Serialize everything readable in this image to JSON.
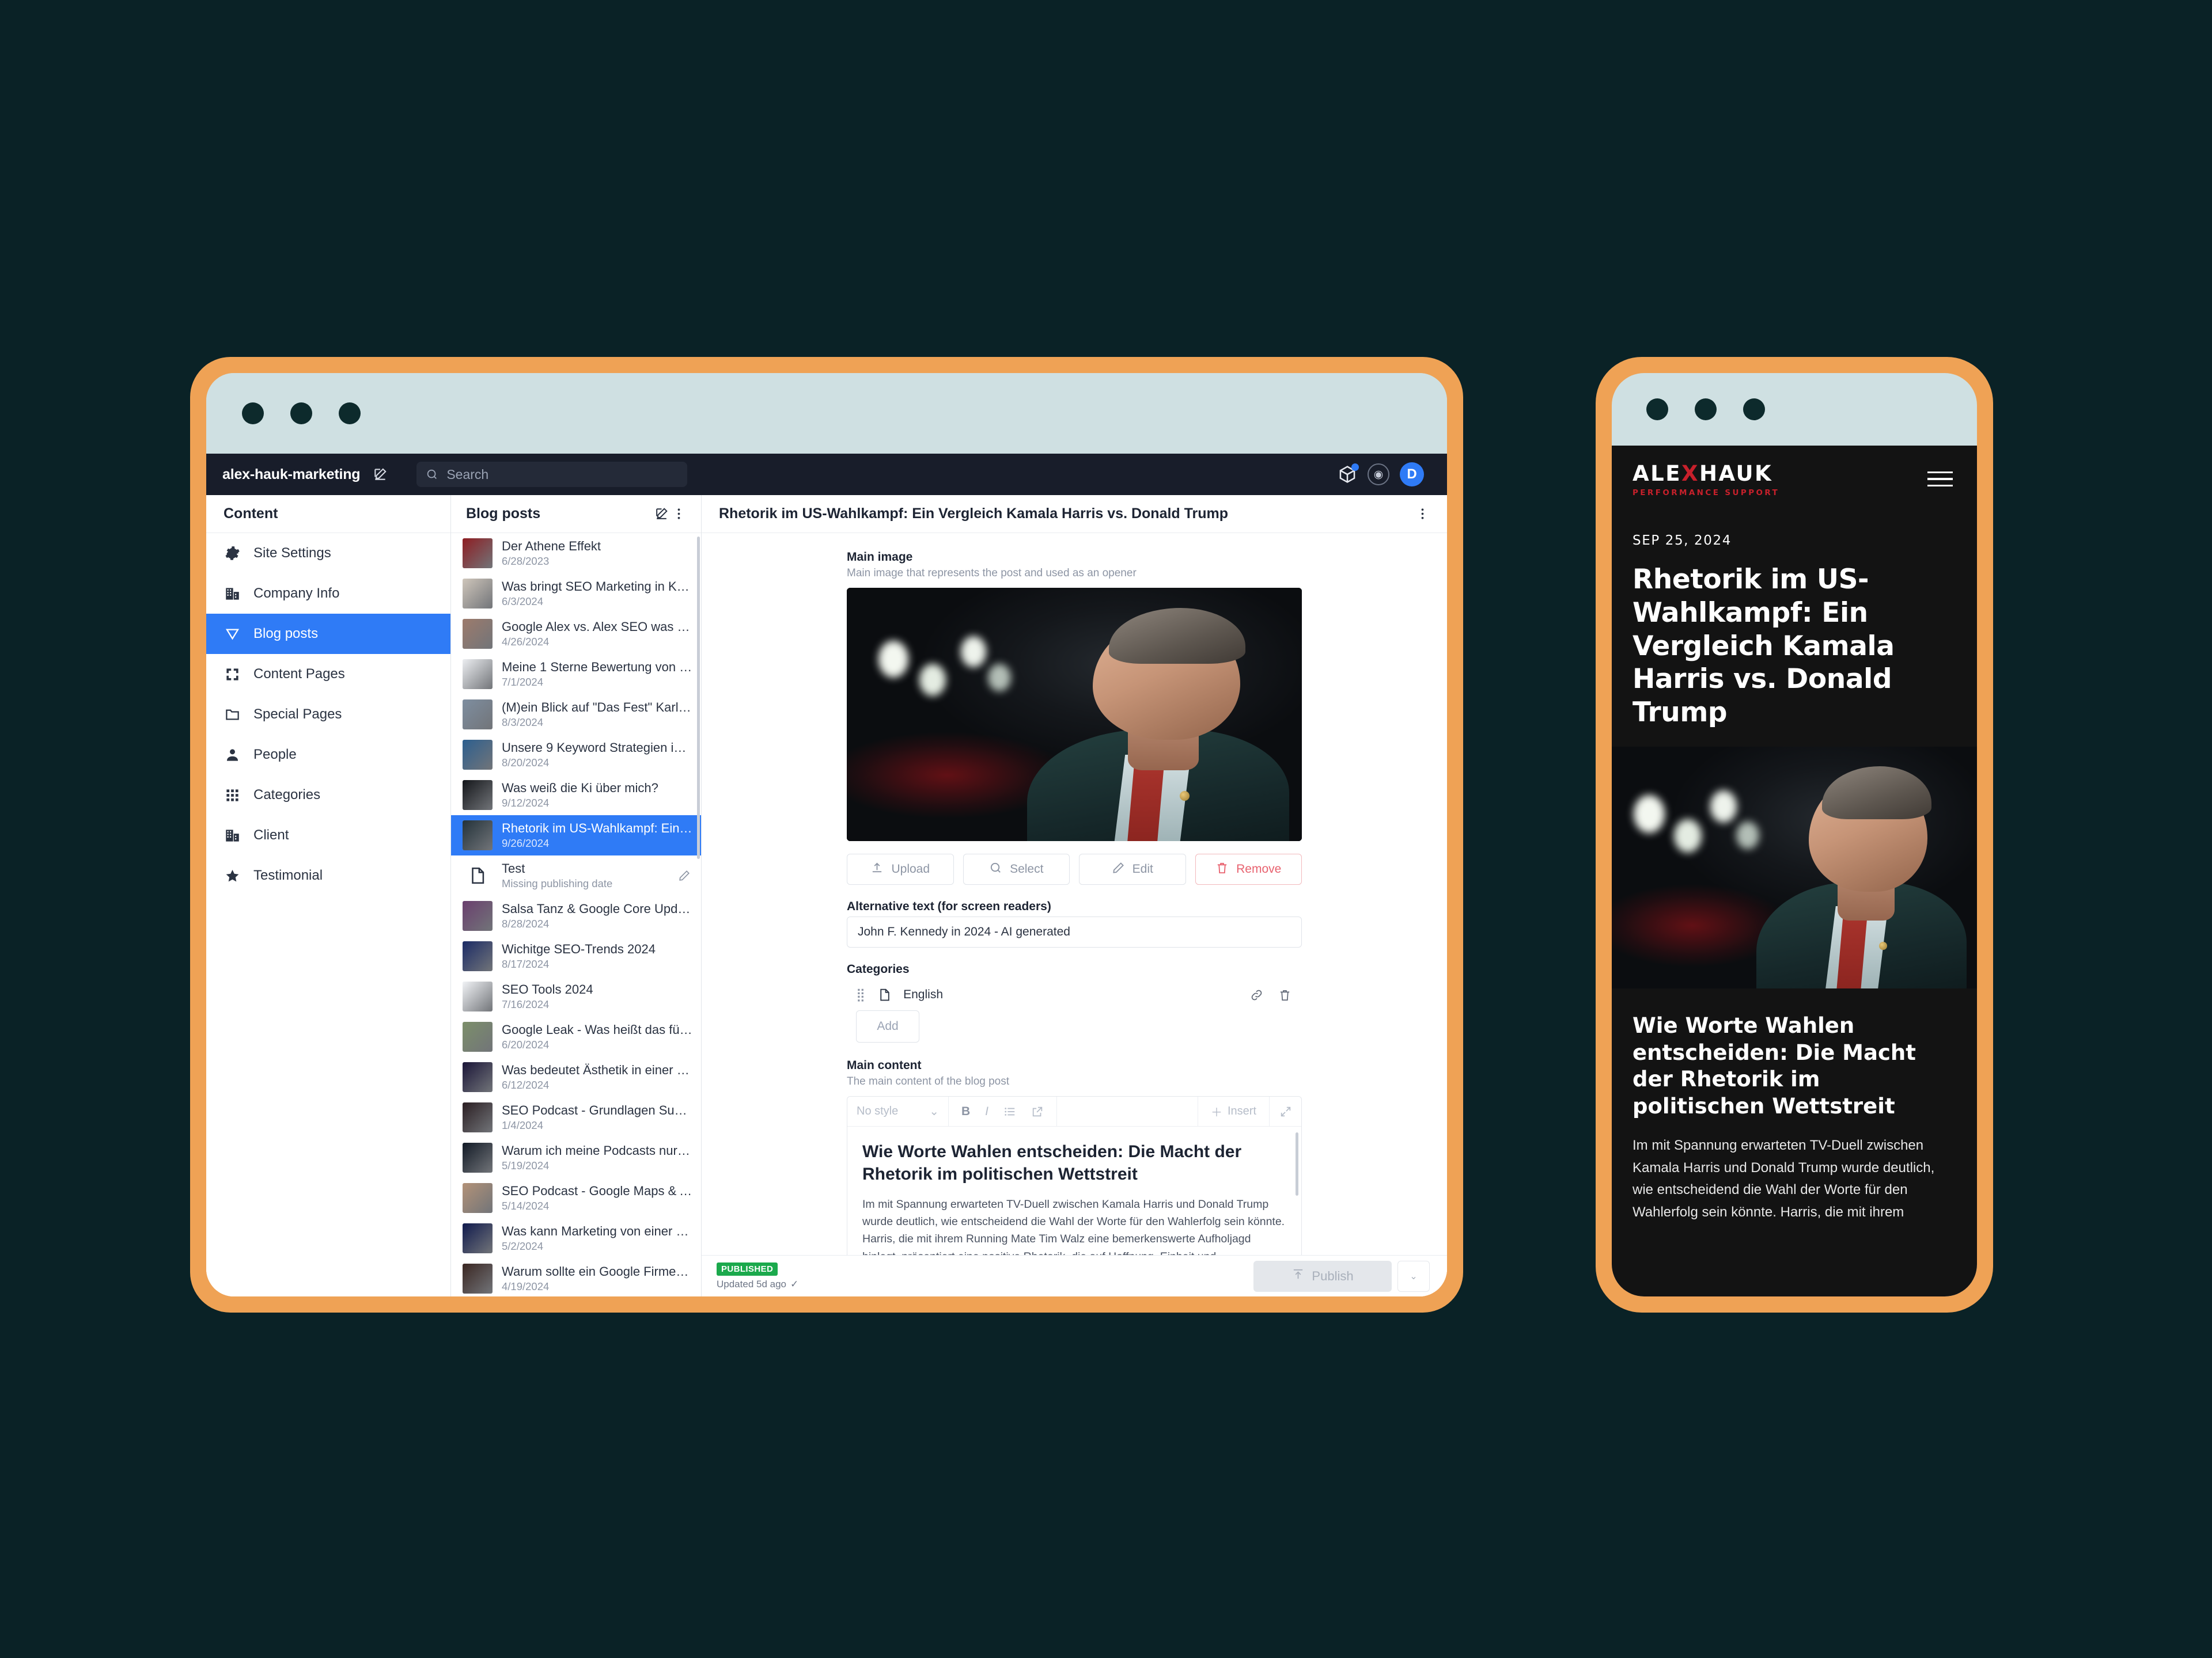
{
  "app": {
    "site_name": "alex-hauk-marketing",
    "edit_icon": "pencil-square-icon",
    "search_placeholder": "Search",
    "search_icon": "search-icon",
    "topbar_icons": [
      "package-icon",
      "help-circle-icon"
    ],
    "avatar_initial": "D",
    "accent_color": "#2f7bf6",
    "frame_color": "#efa255",
    "chrome_color": "#cfe0e2",
    "page_bg": "#0a2226"
  },
  "sidebar": {
    "title": "Content",
    "items": [
      {
        "label": "Site Settings",
        "icon": "gear-icon",
        "active": false
      },
      {
        "label": "Company Info",
        "icon": "building-icon",
        "active": false
      },
      {
        "label": "Blog posts",
        "icon": "funnel-icon",
        "active": true
      },
      {
        "label": "Content Pages",
        "icon": "expand-corners-icon",
        "active": false
      },
      {
        "label": "Special Pages",
        "icon": "folder-icon",
        "active": false
      },
      {
        "label": "People",
        "icon": "person-icon",
        "active": false
      },
      {
        "label": "Categories",
        "icon": "grid-dots-icon",
        "active": false
      },
      {
        "label": "Client",
        "icon": "building-icon",
        "active": false
      },
      {
        "label": "Testimonial",
        "icon": "star-icon",
        "active": false
      }
    ]
  },
  "list": {
    "title": "Blog posts",
    "header_icons": [
      "pencil-square-icon",
      "kebab-menu-icon"
    ],
    "items": [
      {
        "title": "Der Athene Effekt",
        "date": "6/28/2023",
        "selected": false,
        "thumb": "#8e1d22"
      },
      {
        "title": "Was bringt SEO Marketing in Karls...",
        "date": "6/3/2024",
        "selected": false,
        "thumb": "#cfc6bb"
      },
      {
        "title": "Google Alex vs. Alex SEO was brin...",
        "date": "4/26/2024",
        "selected": false,
        "thumb": "#9d7b6c"
      },
      {
        "title": "Meine 1 Sterne Bewertung von Go...",
        "date": "7/1/2024",
        "selected": false,
        "thumb": "#eceef1"
      },
      {
        "title": "(M)ein Blick auf \"Das Fest\" Karlsr...",
        "date": "8/3/2024",
        "selected": false,
        "thumb": "#7e8ea0"
      },
      {
        "title": "Unsere 9 Keyword Strategien im S...",
        "date": "8/20/2024",
        "selected": false,
        "thumb": "#2c5f8f"
      },
      {
        "title": "Was weiß die Ki über mich?",
        "date": "9/12/2024",
        "selected": false,
        "thumb": "#14161a"
      },
      {
        "title": "Rhetorik im US-Wahlkampf: Ein Ve...",
        "date": "9/26/2024",
        "selected": true,
        "thumb": "#23323a"
      },
      {
        "title": "Test",
        "date": "Missing publishing date",
        "selected": false,
        "thumb": "doc",
        "row_action": "pencil-icon"
      },
      {
        "title": "Salsa Tanz & Google Core Update...",
        "date": "8/28/2024",
        "selected": false,
        "thumb": "#6a3f6e"
      },
      {
        "title": "Wichitge SEO-Trends 2024",
        "date": "8/17/2024",
        "selected": false,
        "thumb": "#1b2b66"
      },
      {
        "title": "SEO Tools 2024",
        "date": "7/16/2024",
        "selected": false,
        "thumb": "#f1f3f6"
      },
      {
        "title": "Google Leak - Was heißt das für S...",
        "date": "6/20/2024",
        "selected": false,
        "thumb": "#7c8f6a"
      },
      {
        "title": "Was bedeutet Ästhetik in einer Su...",
        "date": "6/12/2024",
        "selected": false,
        "thumb": "#1a1538"
      },
      {
        "title": "SEO Podcast - Grundlagen Suchm...",
        "date": "1/4/2024",
        "selected": false,
        "thumb": "#2a1e22"
      },
      {
        "title": "Warum ich meine Podcasts nur be...",
        "date": "5/19/2024",
        "selected": false,
        "thumb": "#121a26"
      },
      {
        "title": "SEO Podcast - Google Maps & Au...",
        "date": "5/14/2024",
        "selected": false,
        "thumb": "#b39278"
      },
      {
        "title": "Was kann Marketing von einer Ban...",
        "date": "5/2/2024",
        "selected": false,
        "thumb": "#101a4d"
      },
      {
        "title": "Warum sollte ein Google Firmenei...",
        "date": "4/19/2024",
        "selected": false,
        "thumb": "#3a2622"
      },
      {
        "title": "",
        "date": "",
        "selected": false,
        "thumb": "#b5241c"
      }
    ]
  },
  "editor": {
    "title": "Rhetorik im US-Wahlkampf: Ein Vergleich Kamala Harris vs. Donald Trump",
    "menu_icon": "kebab-menu-icon",
    "main_image": {
      "label": "Main image",
      "help": "Main image that represents the post and used as an opener",
      "buttons": [
        {
          "label": "Upload",
          "icon": "upload-icon",
          "danger": false
        },
        {
          "label": "Select",
          "icon": "search-icon",
          "danger": false
        },
        {
          "label": "Edit",
          "icon": "pencil-icon",
          "danger": false
        },
        {
          "label": "Remove",
          "icon": "trash-icon",
          "danger": true
        }
      ]
    },
    "alt_text": {
      "label": "Alternative text (for screen readers)",
      "value": "John F. Kennedy in 2024 - AI generated"
    },
    "categories": {
      "label": "Categories",
      "rows": [
        {
          "name": "English",
          "icon": "document-icon",
          "actions": [
            "link-icon",
            "trash-icon"
          ]
        }
      ],
      "add_label": "Add"
    },
    "main_content": {
      "label": "Main content",
      "help": "The main content of the blog post",
      "toolbar": {
        "style_select": "No style",
        "bold": "B",
        "italic": "I",
        "list_icon": "bullet-list-icon",
        "link_icon": "external-link-icon",
        "insert_label": "Insert",
        "insert_icon": "plus-icon",
        "expand_icon": "expand-icon"
      },
      "heading": "Wie Worte Wahlen entscheiden: Die Macht der Rhetorik im politischen Wettstreit",
      "paragraph": "Im mit Spannung erwarteten TV-Duell zwischen Kamala Harris und Donald Trump wurde deutlich, wie entscheidend die Wahl der Worte für den Wahlerfolg sein könnte. Harris, die mit ihrem Running Mate Tim Walz eine bemerkenswerte Aufholjagd hinlegt, präsentiert eine positive Rhetorik, die auf Hoffnung, Einheit und"
    },
    "status": {
      "badge": "PUBLISHED",
      "badge_color": "#1ba94c",
      "updated": "Updated 5d ago",
      "check_icon": "check-icon",
      "publish_label": "Publish",
      "publish_icon": "publish-icon",
      "caret_icon": "chevron-down-icon"
    }
  },
  "phone": {
    "logo_main_before": "ALE",
    "logo_main_x": "X",
    "logo_main_after": " HAUK",
    "logo_sub": "PERFORMANCE SUPPORT",
    "menu_icon": "hamburger-menu-icon",
    "date": "SEP 25, 2024",
    "title": "Rhetorik im US-Wahlkampf: Ein Vergleich Kamala Harris vs. Donald Trump",
    "article_heading": "Wie Worte Wahlen entscheiden: Die Macht der Rhetorik im politischen Wettstreit",
    "article_paragraph": "Im mit Spannung erwarteten TV-Duell zwischen Kamala Harris und Donald Trump wurde deutlich, wie entscheidend die Wahl der Worte für den Wahlerfolg sein könnte. Harris, die mit ihrem",
    "brand_red": "#c8202b",
    "screen_bg": "#131313"
  }
}
